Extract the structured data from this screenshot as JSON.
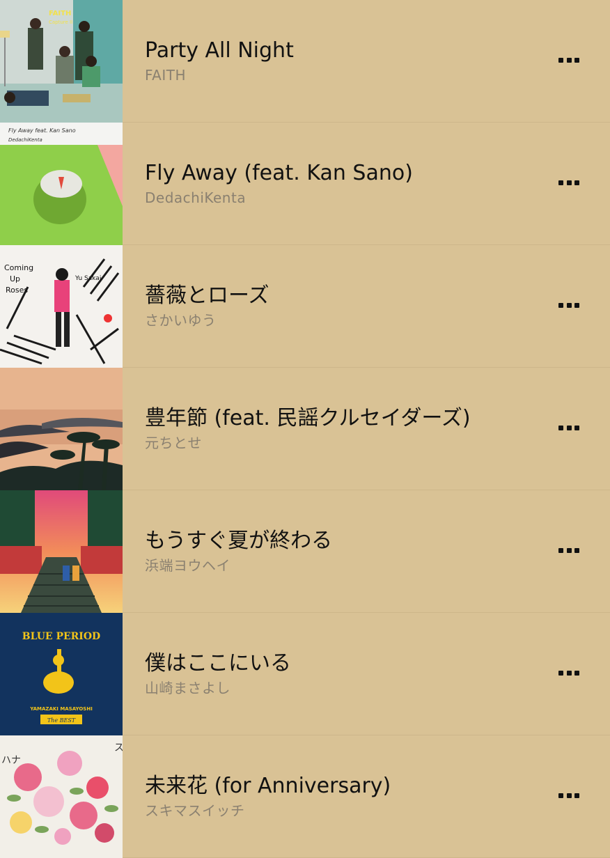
{
  "tracks": [
    {
      "title": "Party All Night",
      "artist": "FAITH",
      "art": "faith-capture-ii"
    },
    {
      "title": "Fly Away (feat. Kan Sano)",
      "artist": "DedachiKenta",
      "art": "fly-away-green"
    },
    {
      "title": "薔薇とローズ",
      "artist": "さかいゆう",
      "art": "coming-up-roses"
    },
    {
      "title": "豊年節 (feat. 民謡クルセイダーズ)",
      "artist": "元ちとせ",
      "art": "sunset-islands"
    },
    {
      "title": "もうすぐ夏が終わる",
      "artist": "浜端ヨウヘイ",
      "art": "summer-stairs"
    },
    {
      "title": "僕はここにいる",
      "artist": "山崎まさよし",
      "art": "blue-period"
    },
    {
      "title": "未来花 (for Anniversary)",
      "artist": "スキマスイッチ",
      "art": "flowers"
    }
  ],
  "album_text": {
    "faith": "FAITH",
    "faith_sub": "Capture II",
    "fly_away": "Fly Away feat. Kan Sano",
    "fly_away_artist": "DedachiKenta",
    "roses_1": "Coming",
    "roses_2": "Up",
    "roses_3": "Roses",
    "roses_artist": "Yu Sakai",
    "blue_period": "BLUE PERIOD",
    "yamazaki": "YAMAZAKI MASAYOSHI",
    "the_best": "The BEST",
    "flowers_side_1": "スキ",
    "flowers_side_2": "ハナ"
  },
  "colors": {
    "background": "#d9c295",
    "separator": "#cdb68a",
    "title": "#111111",
    "artist": "#8a8070"
  }
}
